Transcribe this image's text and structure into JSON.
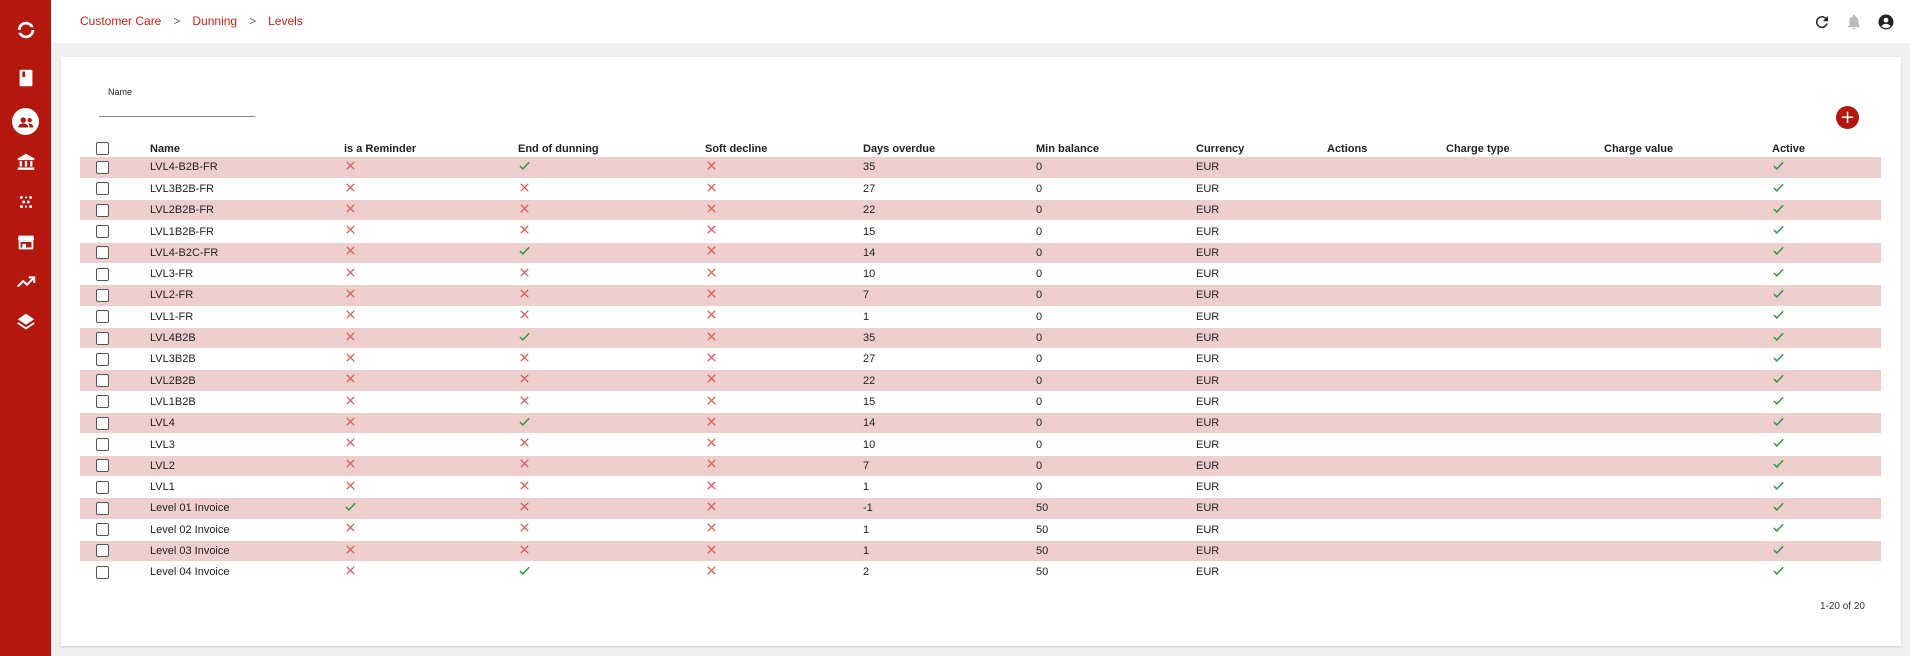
{
  "breadcrumb": {
    "item1": "Customer Care",
    "item2": "Dunning",
    "item3": "Levels"
  },
  "filter": {
    "label": "Name",
    "value": ""
  },
  "table": {
    "headers": {
      "name": "Name",
      "reminder": "is a Reminder",
      "end": "End of dunning",
      "soft": "Soft decline",
      "days": "Days overdue",
      "minbal": "Min balance",
      "currency": "Currency",
      "actions": "Actions",
      "chargetype": "Charge type",
      "chargevalue": "Charge value",
      "active": "Active"
    },
    "rows": [
      {
        "name": "LVL4-B2B-FR",
        "reminder": false,
        "end": true,
        "soft": false,
        "days": "35",
        "minbal": "0",
        "currency": "EUR",
        "active": true
      },
      {
        "name": "LVL3B2B-FR",
        "reminder": false,
        "end": false,
        "soft": false,
        "days": "27",
        "minbal": "0",
        "currency": "EUR",
        "active": true
      },
      {
        "name": "LVL2B2B-FR",
        "reminder": false,
        "end": false,
        "soft": false,
        "days": "22",
        "minbal": "0",
        "currency": "EUR",
        "active": true
      },
      {
        "name": "LVL1B2B-FR",
        "reminder": false,
        "end": false,
        "soft": false,
        "days": "15",
        "minbal": "0",
        "currency": "EUR",
        "active": true
      },
      {
        "name": "LVL4-B2C-FR",
        "reminder": false,
        "end": true,
        "soft": false,
        "days": "14",
        "minbal": "0",
        "currency": "EUR",
        "active": true
      },
      {
        "name": "LVL3-FR",
        "reminder": false,
        "end": false,
        "soft": false,
        "days": "10",
        "minbal": "0",
        "currency": "EUR",
        "active": true
      },
      {
        "name": "LVL2-FR",
        "reminder": false,
        "end": false,
        "soft": false,
        "days": "7",
        "minbal": "0",
        "currency": "EUR",
        "active": true
      },
      {
        "name": "LVL1-FR",
        "reminder": false,
        "end": false,
        "soft": false,
        "days": "1",
        "minbal": "0",
        "currency": "EUR",
        "active": true
      },
      {
        "name": "LVL4B2B",
        "reminder": false,
        "end": true,
        "soft": false,
        "days": "35",
        "minbal": "0",
        "currency": "EUR",
        "active": true
      },
      {
        "name": "LVL3B2B",
        "reminder": false,
        "end": false,
        "soft": false,
        "days": "27",
        "minbal": "0",
        "currency": "EUR",
        "active": true
      },
      {
        "name": "LVL2B2B",
        "reminder": false,
        "end": false,
        "soft": false,
        "days": "22",
        "minbal": "0",
        "currency": "EUR",
        "active": true
      },
      {
        "name": "LVL1B2B",
        "reminder": false,
        "end": false,
        "soft": false,
        "days": "15",
        "minbal": "0",
        "currency": "EUR",
        "active": true
      },
      {
        "name": "LVL4",
        "reminder": false,
        "end": true,
        "soft": false,
        "days": "14",
        "minbal": "0",
        "currency": "EUR",
        "active": true
      },
      {
        "name": "LVL3",
        "reminder": false,
        "end": false,
        "soft": false,
        "days": "10",
        "minbal": "0",
        "currency": "EUR",
        "active": true
      },
      {
        "name": "LVL2",
        "reminder": false,
        "end": false,
        "soft": false,
        "days": "7",
        "minbal": "0",
        "currency": "EUR",
        "active": true
      },
      {
        "name": "LVL1",
        "reminder": false,
        "end": false,
        "soft": false,
        "days": "1",
        "minbal": "0",
        "currency": "EUR",
        "active": true
      },
      {
        "name": "Level 01 Invoice",
        "reminder": true,
        "end": false,
        "soft": false,
        "days": "-1",
        "minbal": "50",
        "currency": "EUR",
        "active": true
      },
      {
        "name": "Level 02 Invoice",
        "reminder": false,
        "end": false,
        "soft": false,
        "days": "1",
        "minbal": "50",
        "currency": "EUR",
        "active": true
      },
      {
        "name": "Level 03 Invoice",
        "reminder": false,
        "end": false,
        "soft": false,
        "days": "1",
        "minbal": "50",
        "currency": "EUR",
        "active": true
      },
      {
        "name": "Level 04 Invoice",
        "reminder": false,
        "end": true,
        "soft": false,
        "days": "2",
        "minbal": "50",
        "currency": "EUR",
        "active": true
      }
    ]
  },
  "pager": {
    "text": "1-20 of 20"
  },
  "colors": {
    "brand": "#b3170e",
    "row_stripe": "#efcfcd",
    "check": "#2e9b3a",
    "cross": "#e05a52",
    "breadcrumb": "#d21d12"
  },
  "icons": {
    "sidebar": [
      "logo-icon",
      "book-icon",
      "customer-care-icon",
      "bank-icon",
      "dots-icon",
      "store-icon",
      "trending-icon",
      "layers-icon"
    ],
    "top": [
      "refresh-icon",
      "bell-icon",
      "account-icon"
    ]
  }
}
